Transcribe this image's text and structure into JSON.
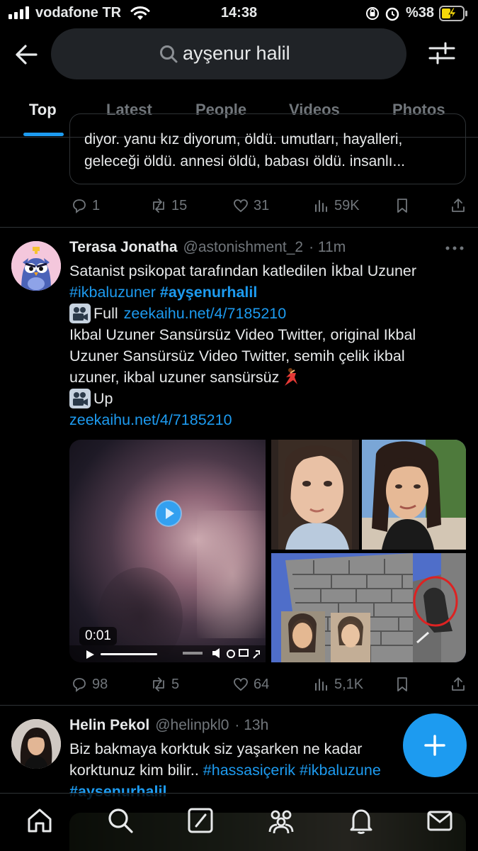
{
  "status_bar": {
    "carrier": "vodafone TR",
    "time": "14:38",
    "battery_percent": "%38"
  },
  "search": {
    "query": "ayşenur halil",
    "icon": "search-icon"
  },
  "tabs": [
    {
      "label": "Top",
      "active": true
    },
    {
      "label": "Latest",
      "active": false
    },
    {
      "label": "People",
      "active": false
    },
    {
      "label": "Videos",
      "active": false
    },
    {
      "label": "Photos",
      "active": false
    }
  ],
  "prev_tweet": {
    "quote_lines": [
      "diyor. yanu kız diyorum, öldü. umutları, hayalleri,",
      "geleceği öldü. annesi öldü, babası öldü. insanlı..."
    ],
    "actions": {
      "replies": "1",
      "retweets": "15",
      "likes": "31",
      "views": "59K"
    }
  },
  "tweet1": {
    "name": "Terasa Jonatha",
    "handle": "@astonishment_2",
    "time": "· 11m",
    "line1": "Satanist psikopat tarafından katledilen İkbal Uzuner",
    "hashtag1": "#ikbaluzuner",
    "hashtag2": "#ayşenurhalil",
    "full_label": "Full",
    "link1": "zeekaihu.net/4/7185210",
    "line4": "Ikbal Uzuner Sansürsüz Video Twitter, original Ikbal",
    "line5": "Uzuner Sansürsüz Video Twitter, semih çelik ikbal",
    "line6": "uzuner, ikbal uzuner sansürsüz",
    "up_label": "Up",
    "link2": "zeekaihu.net/4/7185210",
    "video_time": "0:01",
    "actions": {
      "replies": "98",
      "retweets": "5",
      "likes": "64",
      "views": "5,1K"
    }
  },
  "tweet2": {
    "name": "Helin Pekol",
    "handle": "@helinpkl0",
    "time": "· 13h",
    "line1": "Biz bakmaya korktuk siz yaşarken ne kadar",
    "line2_text": "korktunuz kim bilir..",
    "line2_tag1": "#hassasiçerik",
    "line2_tag2": "#ikbaluzune",
    "line3_tag": "#aysenurhalil"
  },
  "bottom_nav": [
    "home-icon",
    "search-icon",
    "communities-icon",
    "spaces-icon",
    "notifications-icon",
    "messages-icon"
  ],
  "colors": {
    "accent": "#1d9bf0",
    "background": "#000000",
    "muted": "#71767b",
    "text": "#e7e9ea",
    "border": "#2f3336"
  }
}
